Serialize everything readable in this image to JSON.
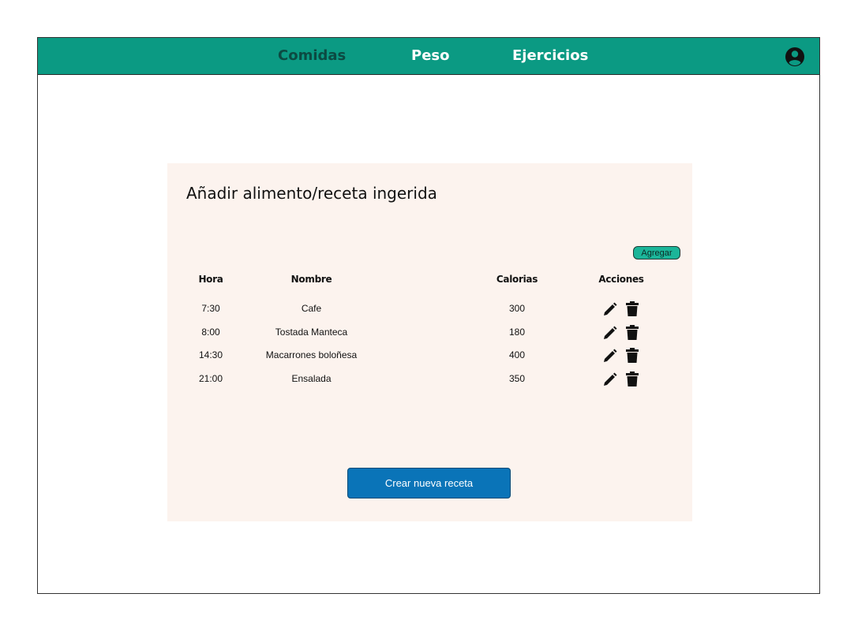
{
  "nav": {
    "items": [
      {
        "label": "Comidas",
        "active": true
      },
      {
        "label": "Peso",
        "active": false
      },
      {
        "label": "Ejercicios",
        "active": false
      }
    ],
    "user_icon": "user-circle-icon"
  },
  "panel": {
    "title": "Añadir alimento/receta ingerida",
    "add_button": "Agregar",
    "table": {
      "headers": {
        "hora": "Hora",
        "nombre": "Nombre",
        "calorias": "Calorias",
        "acciones": "Acciones"
      },
      "rows": [
        {
          "hora": "7:30",
          "nombre": "Cafe",
          "calorias": "300"
        },
        {
          "hora": "8:00",
          "nombre": "Tostada Manteca",
          "calorias": "180"
        },
        {
          "hora": "14:30",
          "nombre": "Macarrones boloñesa",
          "calorias": "400"
        },
        {
          "hora": "21:00",
          "nombre": "Ensalada",
          "calorias": "350"
        }
      ],
      "row_actions": [
        "pencil-icon",
        "trash-icon"
      ]
    },
    "create_button": "Crear nueva receta"
  },
  "colors": {
    "topbar": "#0b9a83",
    "active_nav": "#0c4a42",
    "panel_bg": "#fcf3ee",
    "add_button": "#1bb599",
    "create_button": "#0a74b8"
  }
}
